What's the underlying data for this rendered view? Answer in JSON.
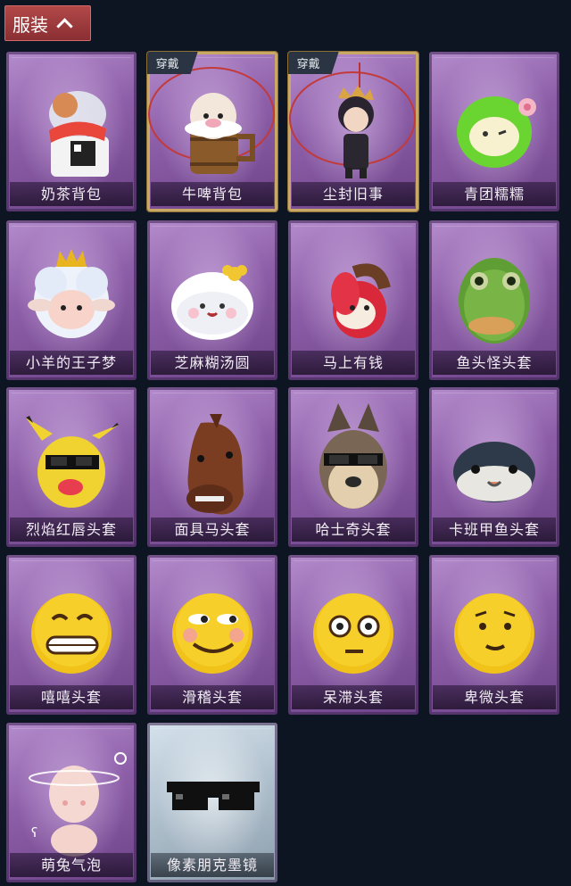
{
  "section": {
    "title": "服装",
    "expanded": true
  },
  "worn_label": "穿戴",
  "items": [
    {
      "name": "奶茶背包",
      "worn": false,
      "icon": "milk-tea-backpack-icon"
    },
    {
      "name": "牛啤背包",
      "worn": true,
      "icon": "cow-beer-backpack-icon"
    },
    {
      "name": "尘封旧事",
      "worn": true,
      "icon": "dusty-past-doll-icon"
    },
    {
      "name": "青团糯糯",
      "worn": false,
      "icon": "green-dumpling-icon"
    },
    {
      "name": "小羊的王子梦",
      "worn": false,
      "icon": "lamb-prince-icon"
    },
    {
      "name": "芝麻糊汤圆",
      "worn": false,
      "icon": "sesame-tangyuan-icon"
    },
    {
      "name": "马上有钱",
      "worn": false,
      "icon": "money-horse-icon"
    },
    {
      "name": "鱼头怪头套",
      "worn": false,
      "icon": "fish-head-mask-icon"
    },
    {
      "name": "烈焰红唇头套",
      "worn": false,
      "icon": "red-lips-mask-icon"
    },
    {
      "name": "面具马头套",
      "worn": false,
      "icon": "horse-head-mask-icon"
    },
    {
      "name": "哈士奇头套",
      "worn": false,
      "icon": "husky-mask-icon"
    },
    {
      "name": "卡班甲鱼头套",
      "worn": false,
      "icon": "kaban-turtle-mask-icon"
    },
    {
      "name": "嘻嘻头套",
      "worn": false,
      "icon": "grinning-emoji-mask-icon"
    },
    {
      "name": "滑稽头套",
      "worn": false,
      "icon": "funny-emoji-mask-icon"
    },
    {
      "name": "呆滞头套",
      "worn": false,
      "icon": "dazed-emoji-mask-icon"
    },
    {
      "name": "卑微头套",
      "worn": false,
      "icon": "humble-emoji-mask-icon"
    },
    {
      "name": "萌兔气泡",
      "worn": false,
      "icon": "cute-rabbit-bubble-icon"
    },
    {
      "name": "像素朋克墨镜",
      "worn": false,
      "icon": "pixel-punk-sunglasses-icon",
      "light": true
    }
  ]
}
